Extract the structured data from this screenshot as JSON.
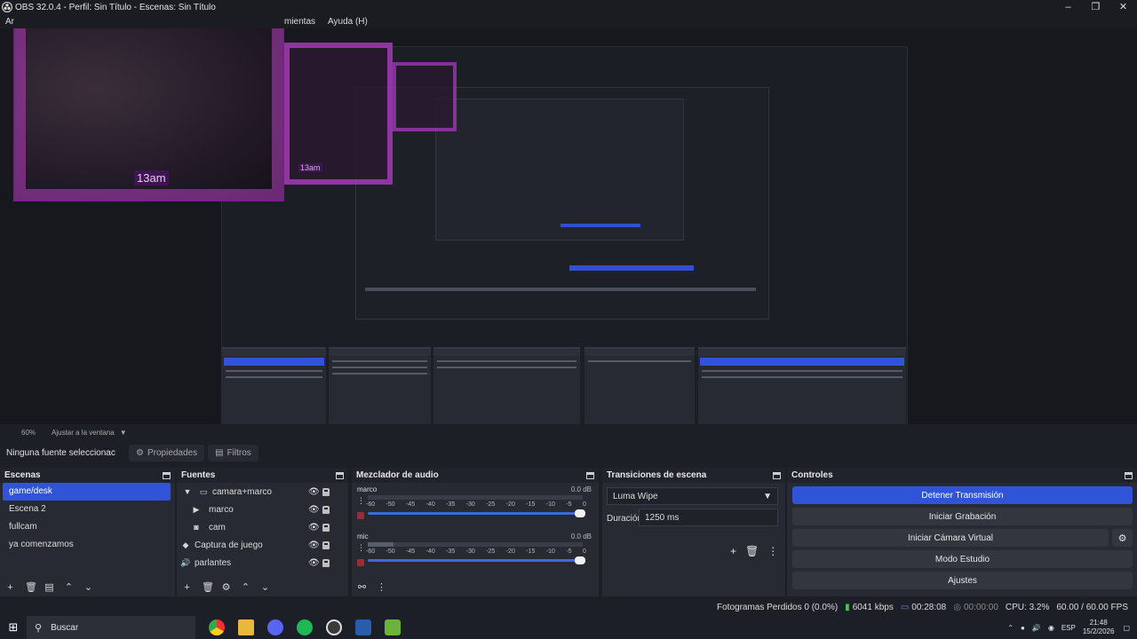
{
  "window": {
    "title": "OBS 32.0.4 - Perfil: Sin Título - Escenas: Sin Título",
    "minimize_icon": "minimize-icon",
    "maximize_icon": "restore-icon",
    "close_icon": "close-icon"
  },
  "menu": {
    "items": [
      "Ar",
      "mientas",
      "Ayuda (H)"
    ]
  },
  "preview": {
    "collage_time": "13am",
    "collage_time_2": "13am"
  },
  "zoom": {
    "level": "60%",
    "fit_label": "Ajustar a la ventana"
  },
  "context": {
    "no_selection": "Ninguna fuente seleccionac",
    "properties_label": "Propiedades",
    "filters_label": "Filtros"
  },
  "scenes": {
    "title": "Escenas",
    "items": [
      "game/desk",
      "Escena 2",
      "fullcam",
      "ya comenzamos"
    ],
    "selected_index": 0
  },
  "sources": {
    "title": "Fuentes",
    "items": [
      {
        "name": "camara+marco",
        "icon": "folder-icon"
      },
      {
        "name": "marco",
        "icon": "play-icon"
      },
      {
        "name": "cam",
        "icon": "camera-icon"
      },
      {
        "name": "Captura de juego",
        "icon": "gamepad-icon"
      },
      {
        "name": "parlantes",
        "icon": "speaker-icon"
      }
    ]
  },
  "mixer": {
    "title": "Mezclador de audio",
    "channels": [
      {
        "name": "marco",
        "db": "0.0 dB",
        "level": 0.0,
        "volume": 1.0
      },
      {
        "name": "mic",
        "db": "0.0 dB",
        "level": 0.12,
        "volume": 1.0
      }
    ],
    "ticks": [
      "-60",
      "-50",
      "-45",
      "-40",
      "-35",
      "-30",
      "-25",
      "-20",
      "-15",
      "-10",
      "-5",
      "0"
    ]
  },
  "transitions": {
    "title": "Transiciones de escena",
    "selected": "Luma Wipe",
    "duration_label": "Duración",
    "duration_value": "1250 ms"
  },
  "controls": {
    "title": "Controles",
    "buttons": [
      "Detener Transmisión",
      "Iniciar Grabación",
      "Iniciar Cámara Virtual",
      "Modo Estudio",
      "Ajustes"
    ]
  },
  "status": {
    "dropped": "Fotogramas Perdidos 0 (0.0%)",
    "kbps": "6041 kbps",
    "stream_time": "00:28:08",
    "rec_time": "00:00:00",
    "cpu": "CPU: 3.2%",
    "fps": "60.00 / 60.00 FPS"
  },
  "taskbar": {
    "search_placeholder": "Buscar",
    "language": "ESP",
    "time": "21:48",
    "date": "15/2/2026"
  },
  "colors": {
    "accent": "#2f54d8",
    "panel": "#272a33",
    "background": "#1d1f26"
  }
}
